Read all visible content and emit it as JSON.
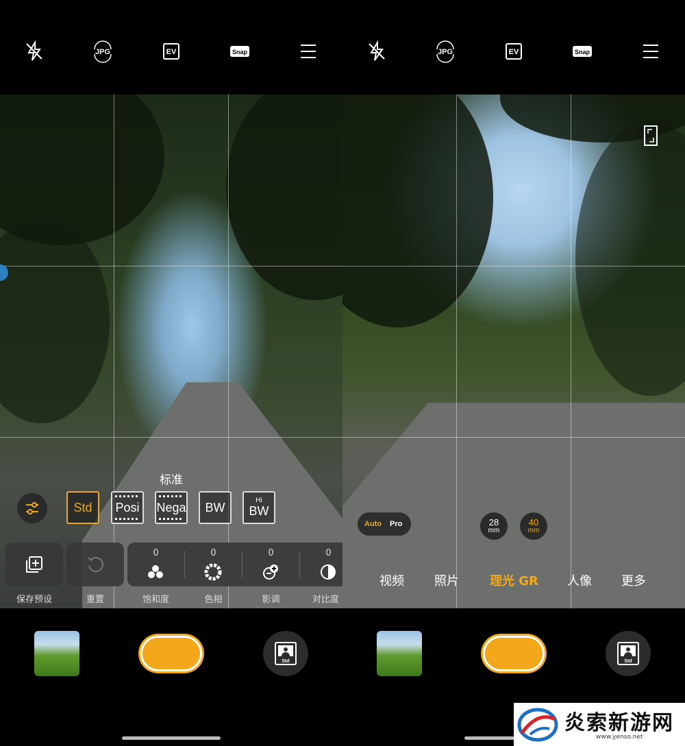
{
  "topbar": {
    "icons": [
      "flash-off-icon",
      "jpg-format-icon",
      "ev-icon",
      "snap-icon",
      "menu-icon"
    ],
    "jpg_label": "JPG",
    "ev_label": "EV",
    "snap_label": "Snap"
  },
  "left_panel": {
    "style_name": "标准",
    "filters": [
      {
        "label": "Std",
        "sub": "",
        "active": true
      },
      {
        "label": "Posi",
        "sub": "",
        "active": false
      },
      {
        "label": "Nega",
        "sub": "",
        "active": false
      },
      {
        "label": "BW",
        "sub": "",
        "active": false
      },
      {
        "label": "BW",
        "sub": "Hi",
        "active": false
      }
    ],
    "tiles": {
      "save_preset": "保存预设",
      "reset": "重置"
    },
    "sliders": [
      {
        "label": "饱和度",
        "value": "0"
      },
      {
        "label": "色相",
        "value": "0"
      },
      {
        "label": "影调",
        "value": "0"
      },
      {
        "label": "对比度",
        "value": "0"
      }
    ],
    "mode_button_label": "Std"
  },
  "right_panel": {
    "auto_label": "Auto",
    "pro_label": "Pro",
    "focal_lengths": [
      {
        "value": "28",
        "unit": "mm",
        "active": false
      },
      {
        "value": "40",
        "unit": "mm",
        "active": true
      }
    ],
    "modes": [
      "视频",
      "照片",
      "理光 GR",
      "人像",
      "更多"
    ],
    "selected_mode": "理光 GR",
    "mode_button_label": "Std"
  },
  "watermark": {
    "text": "炎索新游网",
    "url": "www.yenso.net"
  },
  "colors": {
    "accent": "#f2a81a",
    "background": "#000000"
  }
}
